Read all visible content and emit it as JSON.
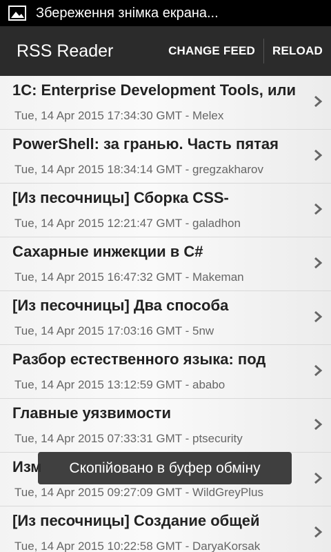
{
  "status_bar": {
    "notification_text": "Збереження знімка екрана..."
  },
  "action_bar": {
    "title": "RSS Reader",
    "change_feed_label": "CHANGE FEED",
    "reload_label": "RELOAD"
  },
  "feed": {
    "items": [
      {
        "title": "1С: Enterprise Development Tools, или",
        "meta": "Tue, 14 Apr 2015 17:34:30 GMT - Melex"
      },
      {
        "title": "PowerShell: за гранью. Часть пятая",
        "meta": "Tue, 14 Apr 2015 18:34:14 GMT - gregzakharov"
      },
      {
        "title": "[Из песочницы] Сборка CSS-",
        "meta": "Tue, 14 Apr 2015 12:21:47 GMT - galadhon"
      },
      {
        "title": "Сахарные инжекции в C#",
        "meta": "Tue, 14 Apr 2015 16:47:32 GMT - Makeman"
      },
      {
        "title": "[Из песочницы] Два способа",
        "meta": "Tue, 14 Apr 2015 17:03:16 GMT - 5nw"
      },
      {
        "title": "Разбор естественного языка: под",
        "meta": "Tue, 14 Apr 2015 13:12:59 GMT - ababo"
      },
      {
        "title": "Главные уязвимости",
        "meta": "Tue, 14 Apr 2015 07:33:31 GMT - ptsecurity"
      },
      {
        "title": "Изм",
        "meta": "Tue, 14 Apr 2015 09:27:09 GMT - WildGreyPlus"
      },
      {
        "title": "[Из песочницы] Создание общей",
        "meta": "Tue, 14 Apr 2015 10:22:58 GMT - DaryaKorsak"
      }
    ]
  },
  "toast": {
    "text": "Скопійовано в буфер обміну"
  }
}
